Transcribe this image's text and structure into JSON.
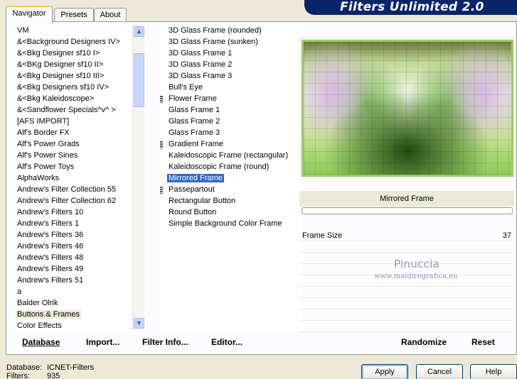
{
  "tabs": [
    {
      "label": "Navigator",
      "active": true
    },
    {
      "label": "Presets",
      "active": false
    },
    {
      "label": "About",
      "active": false
    }
  ],
  "banner": "Filters Unlimited 2.0",
  "categories": [
    {
      "label": "VM",
      "selected": false
    },
    {
      "label": "&<Background Designers IV>",
      "selected": false
    },
    {
      "label": "&<Bkg Designer sf10 I>",
      "selected": false
    },
    {
      "label": "&<BKg Designer sf10 II>",
      "selected": false
    },
    {
      "label": "&<Bkg Designer sf10 III>",
      "selected": false
    },
    {
      "label": "&<Bkg Designers sf10 IV>",
      "selected": false
    },
    {
      "label": "&<Bkg Kaleidoscope>",
      "selected": false
    },
    {
      "label": "&<Sandflower Specials^v^ >",
      "selected": false
    },
    {
      "label": "[AFS IMPORT]",
      "selected": false
    },
    {
      "label": "Alf's Border FX",
      "selected": false
    },
    {
      "label": "Alf's Power Grads",
      "selected": false
    },
    {
      "label": "Alf's Power Sines",
      "selected": false
    },
    {
      "label": "Alf's Power Toys",
      "selected": false
    },
    {
      "label": "AlphaWorks",
      "selected": false
    },
    {
      "label": "Andrew's Filter Collection 55",
      "selected": false
    },
    {
      "label": "Andrew's Filter Collection 62",
      "selected": false
    },
    {
      "label": "Andrew's Filters 10",
      "selected": false
    },
    {
      "label": "Andrew's Filters 1",
      "selected": false
    },
    {
      "label": "Andrew's Filters 36",
      "selected": false
    },
    {
      "label": "Andrew's Filters 46",
      "selected": false
    },
    {
      "label": "Andrew's Filters 48",
      "selected": false
    },
    {
      "label": "Andrew's Filters 49",
      "selected": false
    },
    {
      "label": "Andrew's Filters 51",
      "selected": false
    },
    {
      "label": "a",
      "selected": false
    },
    {
      "label": "Balder Olrik",
      "selected": false
    },
    {
      "label": "Buttons & Frames",
      "selected": true
    },
    {
      "label": "Color Effects",
      "selected": false
    }
  ],
  "filters": [
    {
      "label": "3D Glass Frame (rounded)",
      "group": false,
      "selected": false
    },
    {
      "label": "3D Glass Frame (sunken)",
      "group": false,
      "selected": false
    },
    {
      "label": "3D Glass Frame 1",
      "group": false,
      "selected": false
    },
    {
      "label": "3D Glass Frame 2",
      "group": false,
      "selected": false
    },
    {
      "label": "3D Glass Frame 3",
      "group": false,
      "selected": false
    },
    {
      "label": "Bull's Eye",
      "group": false,
      "selected": false
    },
    {
      "label": "Flower Frame",
      "group": true,
      "selected": false
    },
    {
      "label": "Glass Frame 1",
      "group": false,
      "selected": false
    },
    {
      "label": "Glass Frame 2",
      "group": false,
      "selected": false
    },
    {
      "label": "Glass Frame 3",
      "group": false,
      "selected": false
    },
    {
      "label": "Gradient Frame",
      "group": true,
      "selected": false
    },
    {
      "label": "Kaleidoscopic Frame (rectangular)",
      "group": false,
      "selected": false
    },
    {
      "label": "Kaleidoscopic Frame (round)",
      "group": false,
      "selected": false
    },
    {
      "label": "Mirrored Frame",
      "group": false,
      "selected": true
    },
    {
      "label": "Passepartout",
      "group": true,
      "selected": false
    },
    {
      "label": "Rectangular Button",
      "group": false,
      "selected": false
    },
    {
      "label": "Round Button",
      "group": false,
      "selected": false
    },
    {
      "label": "Simple Background Color Frame",
      "group": false,
      "selected": false
    }
  ],
  "filter_name": "Mirrored Frame",
  "progress": 0,
  "params": [
    {
      "label": "Frame Size",
      "value": "37"
    }
  ],
  "watermark": {
    "name": "Pinuccia",
    "url": "www.maidiregrafica.eu"
  },
  "bottom_buttons": {
    "database": "Database",
    "import": "Import...",
    "filter_info": "Filter Info...",
    "editor": "Editor...",
    "randomize": "Randomize",
    "reset": "Reset"
  },
  "status": {
    "database_label": "Database:",
    "database_value": "ICNET-Filters",
    "filters_label": "Filters:",
    "filters_value": "935"
  },
  "dialog_buttons": {
    "apply": "Apply",
    "cancel": "Cancel",
    "help": "Help"
  },
  "colors": {
    "banner": "#0A246A",
    "selection": "#316AC5",
    "tab_accent": "#FFC73C",
    "dialog_bg": "#ECE9D8"
  }
}
